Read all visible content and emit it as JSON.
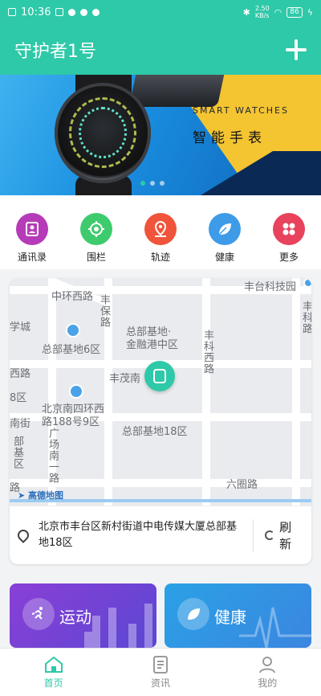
{
  "status_bar": {
    "time": "10:36",
    "network_speed": "2.50\nKB/s",
    "battery": "86"
  },
  "app_bar": {
    "title": "守护者1号",
    "add_icon": "plus-icon"
  },
  "banner": {
    "subtitle": "SMART WATCHES",
    "title": "智能手表",
    "page_count": 3,
    "active_page": 1
  },
  "quick_menu": {
    "items": [
      {
        "label": "通讯录",
        "icon": "contacts-icon",
        "color": "#b53bb8"
      },
      {
        "label": "围栏",
        "icon": "fence-target-icon",
        "color": "#3ecb6e"
      },
      {
        "label": "轨迹",
        "icon": "track-pin-icon",
        "color": "#f0543a"
      },
      {
        "label": "健康",
        "icon": "leaf-icon",
        "color": "#3d9be8"
      },
      {
        "label": "更多",
        "icon": "grid-more-icon",
        "color": "#e8425d"
      }
    ]
  },
  "map": {
    "labels": {
      "l1": "中环西路",
      "l2": "丰台科技园",
      "l3": "学城",
      "l4": "总部基地6区",
      "l5": "总部基地·",
      "l6": "金融港中区",
      "l7": "丰科西路",
      "l8": "丰茂南",
      "l9": "丰保路",
      "l10": "丰科路",
      "l11": "西路",
      "l12": "8区",
      "l13": "北京南四环西",
      "l14": "路188号9区",
      "l15": "总部基地18区",
      "l16": "广场南一路",
      "l17": "南街",
      "l18": "部基区",
      "l19": "六圈路",
      "l20": "路"
    },
    "provider": "高德地图",
    "address": "北京市丰台区新村街道中电传媒大厦总部基地18区",
    "refresh_label": "刷新"
  },
  "feature_cards": [
    {
      "label": "运动",
      "icon": "running-icon",
      "color": "#8a3fd6"
    },
    {
      "label": "健康",
      "icon": "leaf-icon",
      "color": "#2aa1e6"
    }
  ],
  "bottom_nav": {
    "items": [
      {
        "label": "首页",
        "icon": "home-icon",
        "active": true
      },
      {
        "label": "资讯",
        "icon": "news-icon",
        "active": false
      },
      {
        "label": "我的",
        "icon": "profile-icon",
        "active": false
      }
    ]
  },
  "colors": {
    "primary": "#2ec9a8"
  }
}
